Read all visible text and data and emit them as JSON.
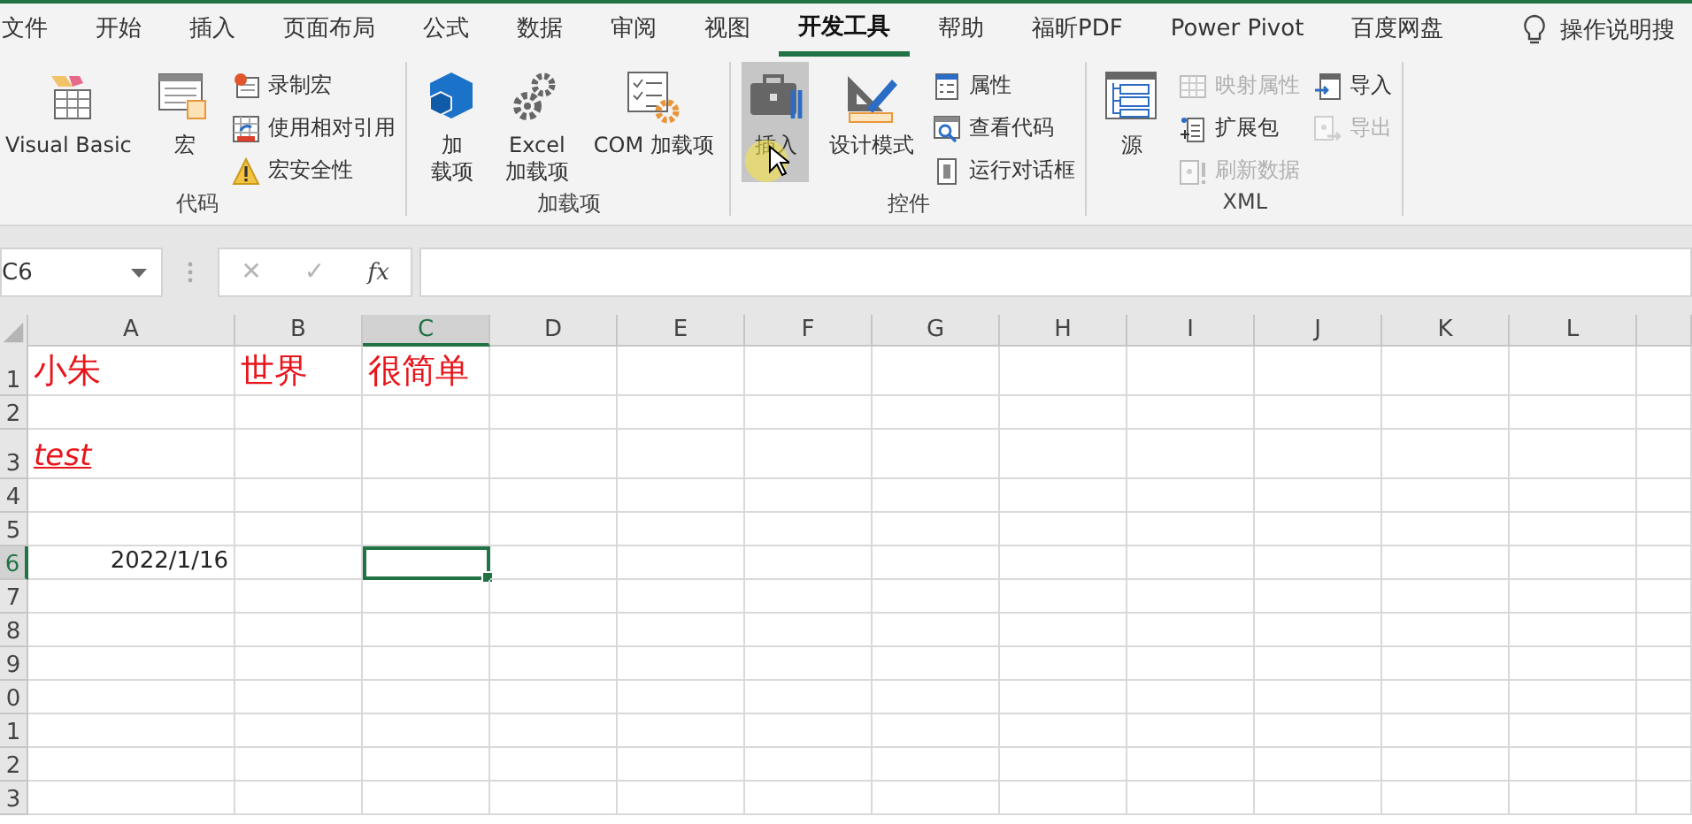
{
  "ribbon_tabs": [
    {
      "label": "文件",
      "selected": false
    },
    {
      "label": "开始",
      "selected": false
    },
    {
      "label": "插入",
      "selected": false
    },
    {
      "label": "页面布局",
      "selected": false
    },
    {
      "label": "公式",
      "selected": false
    },
    {
      "label": "数据",
      "selected": false
    },
    {
      "label": "审阅",
      "selected": false
    },
    {
      "label": "视图",
      "selected": false
    },
    {
      "label": "开发工具",
      "selected": true
    },
    {
      "label": "帮助",
      "selected": false
    },
    {
      "label": "福昕PDF",
      "selected": false
    },
    {
      "label": "Power Pivot",
      "selected": false
    },
    {
      "label": "百度网盘",
      "selected": false
    }
  ],
  "tell_me": {
    "label": "操作说明搜"
  },
  "ribbon_groups": [
    {
      "label": "代码",
      "controls": [
        {
          "kind": "large",
          "lines": [
            "Visual Basic"
          ],
          "disabled": false,
          "hovered": false
        },
        {
          "kind": "large",
          "lines": [
            "宏"
          ],
          "disabled": false,
          "hovered": false
        },
        {
          "kind": "stack",
          "items": [
            {
              "label": "录制宏",
              "disabled": false
            },
            {
              "label": "使用相对引用",
              "disabled": false
            },
            {
              "label": "宏安全性",
              "disabled": false
            }
          ]
        }
      ]
    },
    {
      "label": "加载项",
      "controls": [
        {
          "kind": "large",
          "lines": [
            "加",
            "载项"
          ],
          "disabled": false,
          "hovered": false
        },
        {
          "kind": "large",
          "lines": [
            "Excel",
            "加载项"
          ],
          "disabled": false,
          "hovered": false
        },
        {
          "kind": "large",
          "lines": [
            "COM 加载项"
          ],
          "disabled": false,
          "hovered": false
        }
      ]
    },
    {
      "label": "控件",
      "controls": [
        {
          "kind": "large",
          "lines": [
            "插入"
          ],
          "disabled": false,
          "hovered": true
        },
        {
          "kind": "large",
          "lines": [
            "设计模式"
          ],
          "disabled": false,
          "hovered": false
        },
        {
          "kind": "stack",
          "items": [
            {
              "label": "属性",
              "disabled": false
            },
            {
              "label": "查看代码",
              "disabled": false
            },
            {
              "label": "运行对话框",
              "disabled": false
            }
          ]
        }
      ]
    },
    {
      "label": "XML",
      "controls": [
        {
          "kind": "large",
          "lines": [
            "源"
          ],
          "disabled": false,
          "hovered": false
        },
        {
          "kind": "stack",
          "items": [
            {
              "label": "映射属性",
              "disabled": true
            },
            {
              "label": "扩展包",
              "disabled": false
            },
            {
              "label": "刷新数据",
              "disabled": true
            }
          ]
        },
        {
          "kind": "stack",
          "items": [
            {
              "label": "导入",
              "disabled": false
            },
            {
              "label": "导出",
              "disabled": true
            }
          ]
        }
      ]
    }
  ],
  "formula_bar": {
    "name_box": "C6",
    "cancel_button": "✕",
    "enter_button": "✓",
    "function_button": "fx"
  },
  "columns": [
    {
      "label": "A",
      "selected": false
    },
    {
      "label": "B",
      "selected": false
    },
    {
      "label": "C",
      "selected": true
    },
    {
      "label": "D",
      "selected": false
    },
    {
      "label": "E",
      "selected": false
    },
    {
      "label": "F",
      "selected": false
    },
    {
      "label": "G",
      "selected": false
    },
    {
      "label": "H",
      "selected": false
    },
    {
      "label": "I",
      "selected": false
    },
    {
      "label": "J",
      "selected": false
    },
    {
      "label": "K",
      "selected": false
    },
    {
      "label": "L",
      "selected": false
    }
  ],
  "rows": [
    {
      "label": "1",
      "selected": false,
      "cells": [
        {
          "text": "小朱",
          "kind": "heading",
          "selected": false
        },
        {
          "text": "世界",
          "kind": "heading",
          "selected": false
        },
        {
          "text": "很简单",
          "kind": "heading",
          "selected": false
        },
        {
          "selected": false
        },
        {
          "selected": false
        },
        {
          "selected": false
        },
        {
          "selected": false
        },
        {
          "selected": false
        },
        {
          "selected": false
        },
        {
          "selected": false
        },
        {
          "selected": false
        },
        {
          "selected": false
        }
      ]
    },
    {
      "label": "2",
      "selected": false,
      "cells": [
        {
          "selected": false
        },
        {
          "selected": false
        },
        {
          "selected": false
        },
        {
          "selected": false
        },
        {
          "selected": false
        },
        {
          "selected": false
        },
        {
          "selected": false
        },
        {
          "selected": false
        },
        {
          "selected": false
        },
        {
          "selected": false
        },
        {
          "selected": false
        },
        {
          "selected": false
        }
      ]
    },
    {
      "label": "3",
      "selected": false,
      "cells": [
        {
          "text": "test",
          "kind": "link",
          "selected": false
        },
        {
          "selected": false
        },
        {
          "selected": false
        },
        {
          "selected": false
        },
        {
          "selected": false
        },
        {
          "selected": false
        },
        {
          "selected": false
        },
        {
          "selected": false
        },
        {
          "selected": false
        },
        {
          "selected": false
        },
        {
          "selected": false
        },
        {
          "selected": false
        }
      ]
    },
    {
      "label": "4",
      "selected": false,
      "cells": [
        {
          "selected": false
        },
        {
          "selected": false
        },
        {
          "selected": false
        },
        {
          "selected": false
        },
        {
          "selected": false
        },
        {
          "selected": false
        },
        {
          "selected": false
        },
        {
          "selected": false
        },
        {
          "selected": false
        },
        {
          "selected": false
        },
        {
          "selected": false
        },
        {
          "selected": false
        }
      ]
    },
    {
      "label": "5",
      "selected": false,
      "cells": [
        {
          "selected": false
        },
        {
          "selected": false
        },
        {
          "selected": false
        },
        {
          "selected": false
        },
        {
          "selected": false
        },
        {
          "selected": false
        },
        {
          "selected": false
        },
        {
          "selected": false
        },
        {
          "selected": false
        },
        {
          "selected": false
        },
        {
          "selected": false
        },
        {
          "selected": false
        }
      ]
    },
    {
      "label": "6",
      "selected": true,
      "cells": [
        {
          "text": "2022/1/16",
          "kind": "number",
          "selected": false
        },
        {
          "selected": false
        },
        {
          "selected": true
        },
        {
          "selected": false
        },
        {
          "selected": false
        },
        {
          "selected": false
        },
        {
          "selected": false
        },
        {
          "selected": false
        },
        {
          "selected": false
        },
        {
          "selected": false
        },
        {
          "selected": false
        },
        {
          "selected": false
        }
      ]
    },
    {
      "label": "7",
      "selected": false,
      "cells": [
        {
          "selected": false
        },
        {
          "selected": false
        },
        {
          "selected": false
        },
        {
          "selected": false
        },
        {
          "selected": false
        },
        {
          "selected": false
        },
        {
          "selected": false
        },
        {
          "selected": false
        },
        {
          "selected": false
        },
        {
          "selected": false
        },
        {
          "selected": false
        },
        {
          "selected": false
        }
      ]
    },
    {
      "label": "8",
      "selected": false,
      "cells": [
        {
          "selected": false
        },
        {
          "selected": false
        },
        {
          "selected": false
        },
        {
          "selected": false
        },
        {
          "selected": false
        },
        {
          "selected": false
        },
        {
          "selected": false
        },
        {
          "selected": false
        },
        {
          "selected": false
        },
        {
          "selected": false
        },
        {
          "selected": false
        },
        {
          "selected": false
        }
      ]
    },
    {
      "label": "9",
      "selected": false,
      "cells": [
        {
          "selected": false
        },
        {
          "selected": false
        },
        {
          "selected": false
        },
        {
          "selected": false
        },
        {
          "selected": false
        },
        {
          "selected": false
        },
        {
          "selected": false
        },
        {
          "selected": false
        },
        {
          "selected": false
        },
        {
          "selected": false
        },
        {
          "selected": false
        },
        {
          "selected": false
        }
      ]
    },
    {
      "label": "0",
      "selected": false,
      "cells": [
        {
          "selected": false
        },
        {
          "selected": false
        },
        {
          "selected": false
        },
        {
          "selected": false
        },
        {
          "selected": false
        },
        {
          "selected": false
        },
        {
          "selected": false
        },
        {
          "selected": false
        },
        {
          "selected": false
        },
        {
          "selected": false
        },
        {
          "selected": false
        },
        {
          "selected": false
        }
      ]
    },
    {
      "label": "1",
      "selected": false,
      "cells": [
        {
          "selected": false
        },
        {
          "selected": false
        },
        {
          "selected": false
        },
        {
          "selected": false
        },
        {
          "selected": false
        },
        {
          "selected": false
        },
        {
          "selected": false
        },
        {
          "selected": false
        },
        {
          "selected": false
        },
        {
          "selected": false
        },
        {
          "selected": false
        },
        {
          "selected": false
        }
      ]
    },
    {
      "label": "2",
      "selected": false,
      "cells": [
        {
          "selected": false
        },
        {
          "selected": false
        },
        {
          "selected": false
        },
        {
          "selected": false
        },
        {
          "selected": false
        },
        {
          "selected": false
        },
        {
          "selected": false
        },
        {
          "selected": false
        },
        {
          "selected": false
        },
        {
          "selected": false
        },
        {
          "selected": false
        },
        {
          "selected": false
        }
      ]
    },
    {
      "label": "3",
      "selected": false,
      "cells": [
        {
          "selected": false
        },
        {
          "selected": false
        },
        {
          "selected": false
        },
        {
          "selected": false
        },
        {
          "selected": false
        },
        {
          "selected": false
        },
        {
          "selected": false
        },
        {
          "selected": false
        },
        {
          "selected": false
        },
        {
          "selected": false
        },
        {
          "selected": false
        },
        {
          "selected": false
        }
      ]
    }
  ]
}
